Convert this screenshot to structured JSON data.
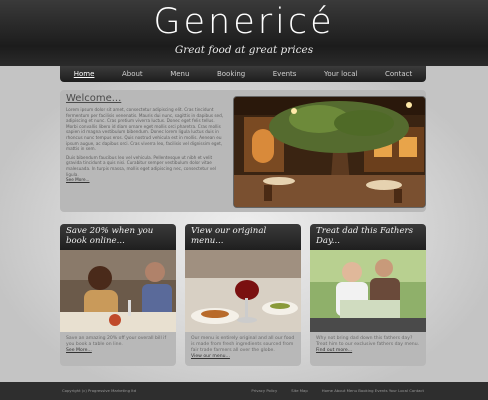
{
  "header": {
    "site_title": "Genericé",
    "tagline": "Great food at great prices"
  },
  "nav": {
    "items": [
      {
        "label": "Home",
        "active": true
      },
      {
        "label": "About"
      },
      {
        "label": "Menu"
      },
      {
        "label": "Booking"
      },
      {
        "label": "Events"
      },
      {
        "label": "Your local"
      },
      {
        "label": "Contact"
      }
    ]
  },
  "welcome": {
    "title": "Welcome...",
    "paragraph1": "Lorem ipsum dolor sit amet, consectetur adipiscing elit. Cras tincidunt fermentum per facilisis venenatis. Mauris dui nunc, sagittis in dapibus sed, adipiscing et nunc. Cras pretium viverra luctus. Donec eget felis tellus. Morbi convallis libero id diam ornare eget mollis orci pharetra. Cras mollis sapien id magna vestibulum bibendum. Donec lorem ligula luctus duis in rhoncus nunc tempus eros. Quis nostrud vehicula est in mollis. Aenean eu ipsum augue, ac dapibus orci. Cras viverra leo, facilisis vel dignissim eget, mattis in sem.",
    "paragraph2": "Duis bibendum faucibus leo vel vehicula. Pellentesque ut nibh et velit gravida tincidunt a quis nisi. Curabitur semper vestibulum dolor vitae malesuada. In turpis massa, mollis eget adipiscing nec, consectetur vel ligula.",
    "see_more": "See More..."
  },
  "columns": [
    {
      "heading": "Save 20% when you book online...",
      "text": "Save an amazing 20% off your overall bill if you book a table on line.",
      "link": "See More..."
    },
    {
      "heading": "View our original menu...",
      "text": "Our menu is entirely original and all our food is made from fresh ingredients sourced from fair trade farmers all over the globe.",
      "link": "View our menu..."
    },
    {
      "heading": "Treat dad this Fathers Day...",
      "text": "Why not bring dad down this fathers day? Treat him to our exclusive fathers day menu.",
      "link": "Find out more..."
    }
  ],
  "footer": {
    "copyright": "Copyright (c) Progressive Marketing ltd",
    "links": [
      "Privacy Policy",
      "Site Map",
      "Home About Menu Booking Events Your Local Contact"
    ]
  }
}
